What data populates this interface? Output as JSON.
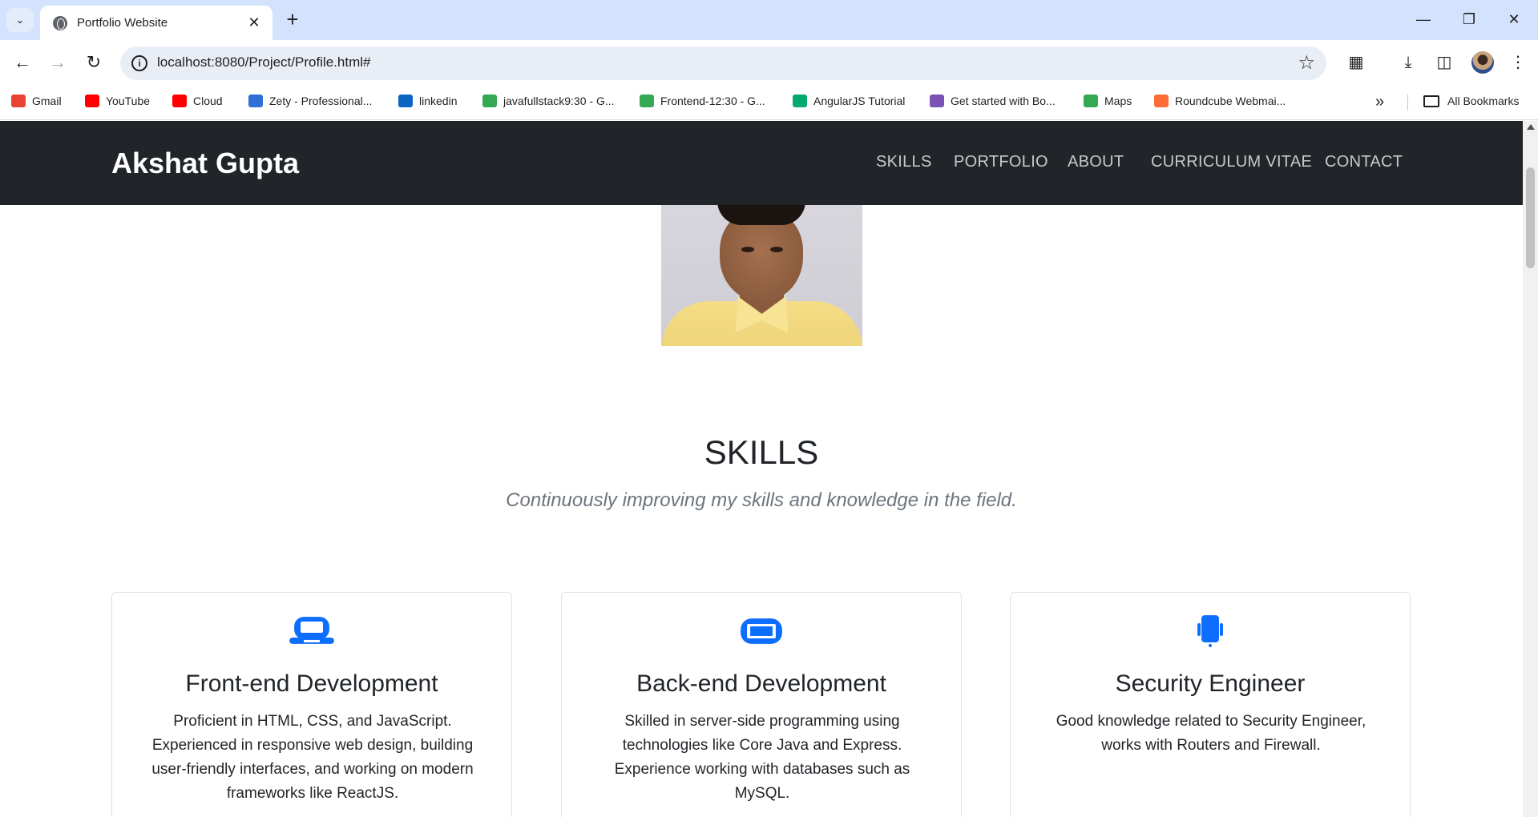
{
  "browser": {
    "tab_title": "Portfolio Website",
    "url": "localhost:8080/Project/Profile.html#",
    "bookmarks": [
      {
        "label": "Gmail",
        "color": "#ea4335"
      },
      {
        "label": "YouTube",
        "color": "#ff0000"
      },
      {
        "label": "Cloud",
        "color": "#ff0000"
      },
      {
        "label": "Zety - Professional...",
        "color": "#2f6fd6"
      },
      {
        "label": "linkedin",
        "color": "#0a66c2"
      },
      {
        "label": "javafullstack9:30 - G...",
        "color": "#34a853"
      },
      {
        "label": "Frontend-12:30 - G...",
        "color": "#34a853"
      },
      {
        "label": "AngularJS Tutorial",
        "color": "#04aa6d"
      },
      {
        "label": "Get started with Bo...",
        "color": "#7952b3"
      },
      {
        "label": "Maps",
        "color": "#34a853"
      },
      {
        "label": "Roundcube Webmai...",
        "color": "#ff6c37"
      }
    ],
    "all_bookmarks_label": "All Bookmarks"
  },
  "site": {
    "brand": "Akshat Gupta",
    "nav": [
      "SKILLS",
      "PORTFOLIO",
      "ABOUT",
      "CURRICULUM VITAE",
      "CONTACT"
    ]
  },
  "skills": {
    "title": "SKILLS",
    "subtitle": "Continuously improving my skills and knowledge in the field.",
    "accent_color": "#0d6efd",
    "cards": [
      {
        "icon": "laptop-icon",
        "title": "Front-end Development",
        "text": "Proficient in HTML, CSS, and JavaScript. Experienced in responsive web design, building user-friendly interfaces, and working on modern frameworks like ReactJS."
      },
      {
        "icon": "server-icon",
        "title": "Back-end Development",
        "text": "Skilled in server-side programming using technologies like Core Java and Express. Experience working with databases such as MySQL."
      },
      {
        "icon": "mobile-icon",
        "title": "Security Engineer",
        "text": "Good knowledge related to Security Engineer, works with Routers and Firewall."
      }
    ]
  }
}
